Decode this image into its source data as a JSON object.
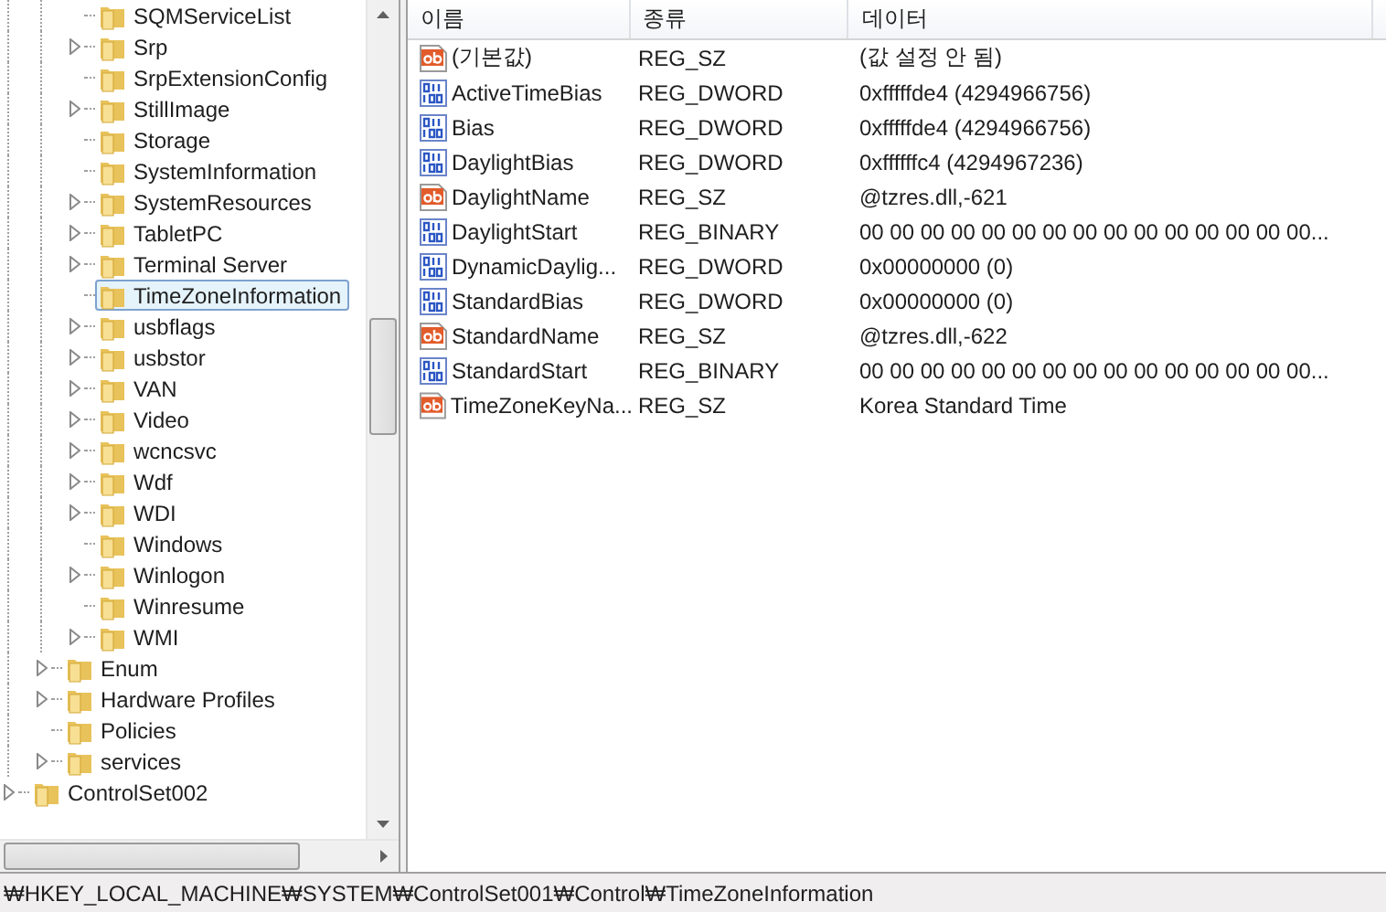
{
  "tree": [
    {
      "children": [
        {
          "children": [
            {
              "label": "SQMServiceList",
              "expandable": false,
              "selected": false
            },
            {
              "label": "Srp",
              "expandable": true,
              "selected": false
            },
            {
              "label": "SrpExtensionConfig",
              "expandable": false,
              "selected": false
            },
            {
              "label": "StillImage",
              "expandable": true,
              "selected": false
            },
            {
              "label": "Storage",
              "expandable": false,
              "selected": false
            },
            {
              "label": "SystemInformation",
              "expandable": false,
              "selected": false
            },
            {
              "label": "SystemResources",
              "expandable": true,
              "selected": false
            },
            {
              "label": "TabletPC",
              "expandable": true,
              "selected": false
            },
            {
              "label": "Terminal Server",
              "expandable": true,
              "selected": false
            },
            {
              "label": "TimeZoneInformation",
              "expandable": false,
              "selected": true
            },
            {
              "label": "usbflags",
              "expandable": true,
              "selected": false
            },
            {
              "label": "usbstor",
              "expandable": true,
              "selected": false
            },
            {
              "label": "VAN",
              "expandable": true,
              "selected": false
            },
            {
              "label": "Video",
              "expandable": true,
              "selected": false
            },
            {
              "label": "wcncsvc",
              "expandable": true,
              "selected": false
            },
            {
              "label": "Wdf",
              "expandable": true,
              "selected": false
            },
            {
              "label": "WDI",
              "expandable": true,
              "selected": false
            },
            {
              "label": "Windows",
              "expandable": false,
              "selected": false
            },
            {
              "label": "Winlogon",
              "expandable": true,
              "selected": false
            },
            {
              "label": "Winresume",
              "expandable": false,
              "selected": false
            },
            {
              "label": "WMI",
              "expandable": true,
              "selected": false
            }
          ]
        },
        {
          "label": "Enum",
          "expandable": true,
          "selected": false
        },
        {
          "label": "Hardware Profiles",
          "expandable": true,
          "selected": false
        },
        {
          "label": "Policies",
          "expandable": false,
          "selected": false
        },
        {
          "label": "services",
          "expandable": true,
          "selected": false
        }
      ]
    },
    {
      "label": "ControlSet002",
      "expandable": true,
      "selected": false
    }
  ],
  "table": {
    "columns": [
      "이름",
      "종류",
      "데이터"
    ],
    "rows": [
      {
        "kind": "string",
        "name": "(기본값)",
        "type": "REG_SZ",
        "data": "(값 설정 안 됨)"
      },
      {
        "kind": "binary",
        "name": "ActiveTimeBias",
        "type": "REG_DWORD",
        "data": "0xfffffde4 (4294966756)"
      },
      {
        "kind": "binary",
        "name": "Bias",
        "type": "REG_DWORD",
        "data": "0xfffffde4 (4294966756)"
      },
      {
        "kind": "binary",
        "name": "DaylightBias",
        "type": "REG_DWORD",
        "data": "0xffffffc4 (4294967236)"
      },
      {
        "kind": "string",
        "name": "DaylightName",
        "type": "REG_SZ",
        "data": "@tzres.dll,-621"
      },
      {
        "kind": "binary",
        "name": "DaylightStart",
        "type": "REG_BINARY",
        "data": "00 00 00 00 00 00 00 00 00 00 00 00 00 00 00..."
      },
      {
        "kind": "binary",
        "name": "DynamicDaylig...",
        "type": "REG_DWORD",
        "data": "0x00000000 (0)"
      },
      {
        "kind": "binary",
        "name": "StandardBias",
        "type": "REG_DWORD",
        "data": "0x00000000 (0)"
      },
      {
        "kind": "string",
        "name": "StandardName",
        "type": "REG_SZ",
        "data": "@tzres.dll,-622"
      },
      {
        "kind": "binary",
        "name": "StandardStart",
        "type": "REG_BINARY",
        "data": "00 00 00 00 00 00 00 00 00 00 00 00 00 00 00..."
      },
      {
        "kind": "string",
        "name": "TimeZoneKeyNa...",
        "type": "REG_SZ",
        "data": "Korea Standard Time"
      }
    ]
  },
  "status_bar": "₩HKEY_LOCAL_MACHINE₩SYSTEM₩ControlSet001₩Control₩TimeZoneInformation"
}
